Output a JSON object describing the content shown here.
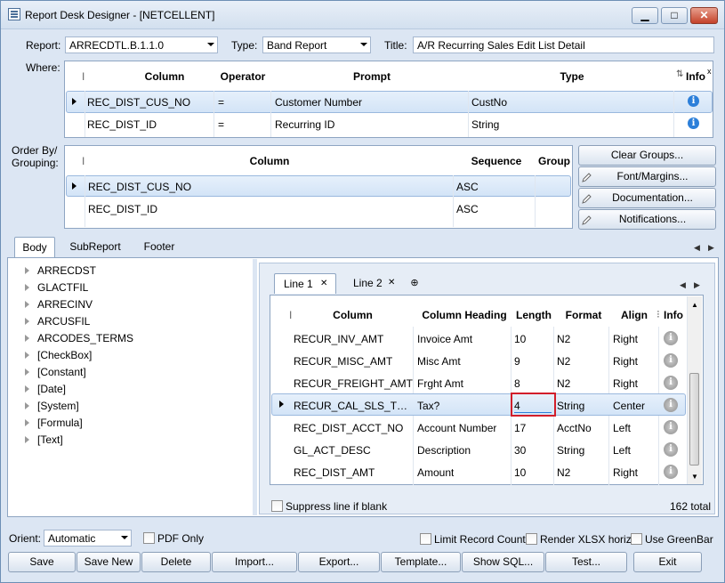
{
  "window": {
    "title": "Report Desk Designer - [NETCELLENT]",
    "minimize": "▁",
    "maximize": "□",
    "close": "✕"
  },
  "header": {
    "report_label": "Report:",
    "report_value": "ARRECDTL.B.1.1.0",
    "type_label": "Type:",
    "type_value": "Band Report",
    "title_label": "Title:",
    "title_value": "A/R Recurring Sales Edit List Detail"
  },
  "where": {
    "label": "Where:",
    "columns": [
      "Column",
      "Operator",
      "Prompt",
      "Type",
      "Info"
    ],
    "rows": [
      {
        "column": "REC_DIST_CUS_NO",
        "operator": "=",
        "prompt": "Customer Number",
        "type": "CustNo"
      },
      {
        "column": "REC_DIST_ID",
        "operator": "=",
        "prompt": "Recurring ID",
        "type": "String"
      }
    ]
  },
  "order": {
    "label": "Order By/ Grouping:",
    "columns": [
      "Column",
      "Sequence",
      "Group"
    ],
    "rows": [
      {
        "column": "REC_DIST_CUS_NO",
        "sequence": "ASC"
      },
      {
        "column": "REC_DIST_ID",
        "sequence": "ASC"
      }
    ]
  },
  "side_buttons": [
    "Clear Groups...",
    "Font/Margins...",
    "Documentation...",
    "Notifications..."
  ],
  "body_tabs": [
    "Body",
    "SubReport",
    "Footer"
  ],
  "tree": [
    "ARRECDST",
    "GLACTFIL",
    "ARRECINV",
    "ARCUSFIL",
    "ARCODES_TERMS",
    "[CheckBox]",
    "[Constant]",
    "[Date]",
    "[System]",
    "[Formula]",
    "[Text]"
  ],
  "line_tabs": [
    "Line 1",
    "Line 2"
  ],
  "lines": {
    "columns": [
      "Column",
      "Column Heading",
      "Length",
      "Format",
      "Align",
      "Info"
    ],
    "rows": [
      {
        "column": "RECUR_INV_AMT",
        "heading": "Invoice Amt",
        "length": "10",
        "format": "N2",
        "align": "Right"
      },
      {
        "column": "RECUR_MISC_AMT",
        "heading": "Misc Amt",
        "length": "9",
        "format": "N2",
        "align": "Right"
      },
      {
        "column": "RECUR_FREIGHT_AMT",
        "heading": "Frght Amt",
        "length": "8",
        "format": "N2",
        "align": "Right"
      },
      {
        "column": "RECUR_CAL_SLS_TX_...",
        "heading": "Tax?",
        "length": "4",
        "format": "String",
        "align": "Center"
      },
      {
        "column": "REC_DIST_ACCT_NO",
        "heading": "Account Number",
        "length": "17",
        "format": "AcctNo",
        "align": "Left"
      },
      {
        "column": "GL_ACT_DESC",
        "heading": "Description",
        "length": "30",
        "format": "String",
        "align": "Left"
      },
      {
        "column": "REC_DIST_AMT",
        "heading": "Amount",
        "length": "10",
        "format": "N2",
        "align": "Right"
      }
    ],
    "suppress_label": "Suppress line if blank",
    "total": "162 total"
  },
  "bottom": {
    "orient_label": "Orient:",
    "orient_value": "Automatic",
    "pdf_only": "PDF Only",
    "limit_record": "Limit Record Count",
    "render_xlsx": "Render XLSX horiz.",
    "use_greenbar": "Use GreenBar"
  },
  "actions": [
    "Save",
    "Save New",
    "Delete",
    "Import...",
    "Export...",
    "Template...",
    "Show SQL...",
    "Test...",
    "Exit"
  ],
  "colors": {
    "accent": "#2c7fd9",
    "highlight": "#d21e2a"
  }
}
